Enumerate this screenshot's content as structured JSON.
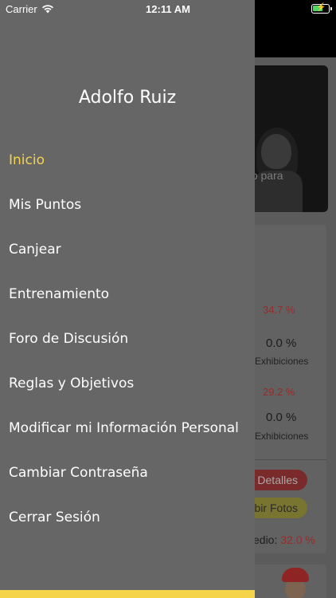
{
  "status_bar": {
    "carrier": "Carrier",
    "time": "12:11 AM",
    "icons": [
      "wifi-icon",
      "battery-charging-icon"
    ]
  },
  "drawer": {
    "user_name": "Adolfo Ruiz",
    "accent_color": "#f6d44a",
    "background_color": "#666666",
    "items": [
      {
        "label": "Inicio",
        "active": true
      },
      {
        "label": "Mis Puntos",
        "active": false
      },
      {
        "label": "Canjear",
        "active": false
      },
      {
        "label": "Entrenamiento",
        "active": false
      },
      {
        "label": "Foro de Discusión",
        "active": false
      },
      {
        "label": "Reglas y Objetivos",
        "active": false
      },
      {
        "label": "Modificar mi Información Personal",
        "active": false
      },
      {
        "label": "Cambiar Contraseña",
        "active": false
      },
      {
        "label": "Cerrar Sesión",
        "active": false
      }
    ]
  },
  "background": {
    "banner_text": "do para",
    "stats": [
      {
        "percent": "34.7 %",
        "value": "0.0 %",
        "label": "Exhibiciones"
      },
      {
        "percent": "29.2 %",
        "value": "0.0 %",
        "label": "Exhibiciones"
      }
    ],
    "details_button": "Detalles",
    "photos_button": "bir Fotos",
    "average_label": "edio:",
    "average_value": "32.0 %"
  }
}
